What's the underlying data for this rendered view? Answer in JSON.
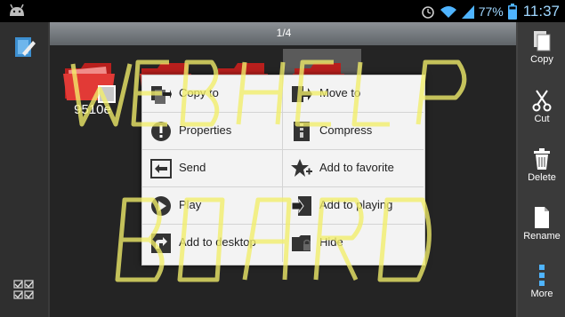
{
  "status_bar": {
    "battery_percent": "77%",
    "time": "11:37",
    "icons": [
      "android-debug-icon",
      "alarm-icon",
      "wifi-icon",
      "signal-icon",
      "battery-icon"
    ]
  },
  "header": {
    "page_indicator": "1/4"
  },
  "files": [
    {
      "name": "9510e",
      "icon": "folder-icon"
    },
    {
      "name": "",
      "icon": "folder-icon"
    },
    {
      "name": "",
      "icon": "folder-icon"
    },
    {
      "name": "",
      "icon": "folder-icon"
    }
  ],
  "context_menu": {
    "items": [
      {
        "label": "Copy to",
        "icon": "copy-to-icon"
      },
      {
        "label": "Move to",
        "icon": "move-to-icon"
      },
      {
        "label": "Properties",
        "icon": "info-icon"
      },
      {
        "label": "Compress",
        "icon": "compress-icon"
      },
      {
        "label": "Send",
        "icon": "send-icon"
      },
      {
        "label": "Add to favorite",
        "icon": "favorite-icon"
      },
      {
        "label": "Play",
        "icon": "play-icon"
      },
      {
        "label": "Add to playing",
        "icon": "playlist-add-icon"
      },
      {
        "label": "Add to desktop",
        "icon": "desktop-shortcut-icon"
      },
      {
        "label": "Hide",
        "icon": "hide-folder-icon"
      }
    ]
  },
  "toolbar": {
    "copy_label": "Copy",
    "cut_label": "Cut",
    "delete_label": "Delete",
    "rename_label": "Rename",
    "more_label": "More"
  },
  "watermark": {
    "text": "WEBHELP BOARD"
  },
  "colors": {
    "accent": "#9fd7ff",
    "watermark": "#f2ee6a",
    "folder": "#e23a36",
    "menu_bg": "#f3f3f3"
  }
}
